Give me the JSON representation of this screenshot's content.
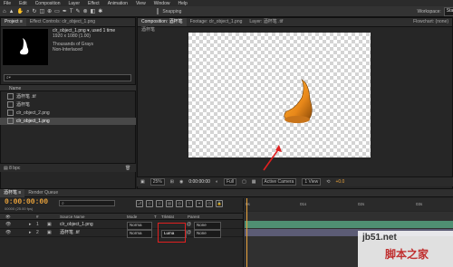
{
  "menubar": {
    "items": [
      "File",
      "Edit",
      "Composition",
      "Layer",
      "Effect",
      "Animation",
      "View",
      "Window",
      "Help"
    ]
  },
  "toolbar": {
    "snapping_label": "Snapping",
    "workspace_label": "Workspace:",
    "workspace_value": "Standard"
  },
  "project_panel": {
    "tab_project": "Project ≡",
    "tab_effect": "Effect Controls: clr_object_1.png",
    "asset_name": "clr_object_1.png ▾, used 1 time",
    "asset_dims": "1920 x 1080 (1.00)",
    "asset_color": "Thousands of Grays",
    "asset_interlace": "Non-Interlaced",
    "search_icon": "search-icon",
    "column_name": "Name",
    "items": [
      "酒杯笔 .tif",
      "酒杯笔",
      "clr_object_2.png",
      "clr_object_1.png"
    ],
    "bpc": "8 bpc"
  },
  "comp_panel": {
    "tab_comp": "Composition: 酒杯笔",
    "tab_footage": "Footage: clr_object_1.png",
    "tab_layer": "Layer: 酒杯笔 .tif",
    "flowchart": "Flowchart: (none)",
    "sub_tab": "酒杯笔",
    "zoom": "25%",
    "timecode": "0:00:00:00",
    "resolution": "Full",
    "camera": "Active Camera",
    "view": "1 View",
    "exposure": "+0.0"
  },
  "timeline": {
    "tab_comp": "酒杯笔 ≡",
    "tab_render": "Render Queue",
    "timecode": "0:00:00:00",
    "timecode_sub": "00000 (25.00 fps)",
    "columns": [
      "#",
      "Source Name",
      "Mode",
      "T",
      "TrkMat",
      "Parent"
    ],
    "layers": [
      {
        "num": "1",
        "name": "clr_object_1.png",
        "mode": "Norma",
        "trkmat": "",
        "parent": "None"
      },
      {
        "num": "2",
        "name": "酒杯笔 .tif",
        "mode": "Norma",
        "trkmat": "Luma",
        "parent": "None"
      }
    ],
    "ruler": [
      "0s",
      "01s",
      "02s",
      "03s"
    ]
  },
  "watermark": {
    "url": "jb51.net",
    "cn": "脚本之家"
  },
  "colors": {
    "accent": "#e9a23b",
    "highlight": "#e02020",
    "bar1": "#4f8f72",
    "bar2": "#5c5c75"
  }
}
